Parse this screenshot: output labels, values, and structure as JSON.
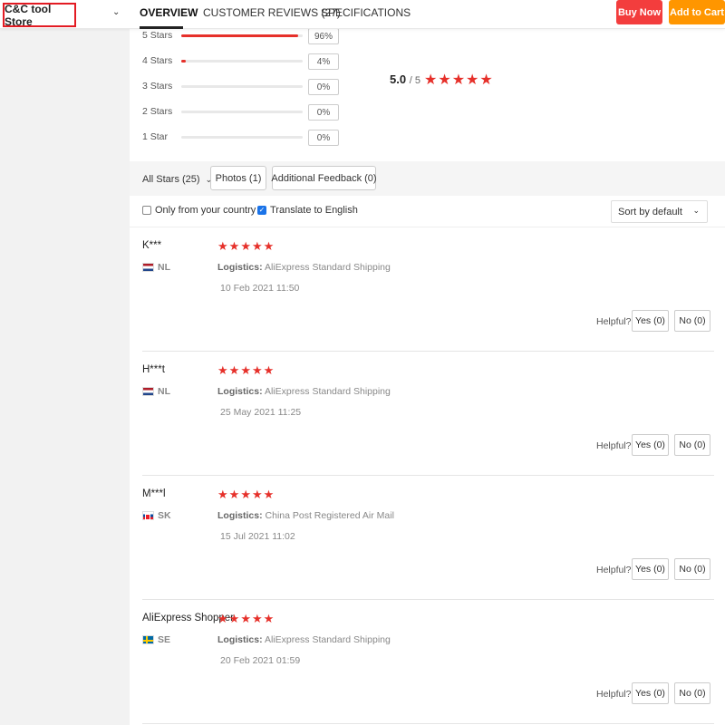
{
  "nav": {
    "store_name": "C&C tool Store",
    "tabs": [
      "OVERVIEW",
      "CUSTOMER REVIEWS (27)",
      "SPECIFICATIONS"
    ],
    "buy_now": "Buy Now",
    "add_to_cart": "Add to Cart"
  },
  "histogram": [
    {
      "label": "5 Stars",
      "pct": "96%",
      "fraction": 0.96
    },
    {
      "label": "4 Stars",
      "pct": "4%",
      "fraction": 0.04
    },
    {
      "label": "3 Stars",
      "pct": "0%",
      "fraction": 0
    },
    {
      "label": "2 Stars",
      "pct": "0%",
      "fraction": 0
    },
    {
      "label": "1 Star",
      "pct": "0%",
      "fraction": 0
    }
  ],
  "score": {
    "value": "5.0",
    "out_of": "/ 5",
    "stars": 5
  },
  "filters": {
    "all_stars": "All Stars (25)",
    "photos": "Photos (1)",
    "additional": "Additional Feedback (0)",
    "only_country": "Only from your country",
    "only_country_checked": false,
    "translate": "Translate to English",
    "translate_checked": true,
    "sort": "Sort by default"
  },
  "review_labels": {
    "logistics": "Logistics:",
    "helpful": "Helpful?",
    "yes": "Yes (0)",
    "no": "No (0)"
  },
  "reviews": [
    {
      "name": "K***",
      "country": "NL",
      "flag": "nl",
      "stars": 5,
      "logistics": "AliExpress Standard Shipping",
      "date": "10 Feb 2021 11:50"
    },
    {
      "name": "H***t",
      "country": "NL",
      "flag": "nl",
      "stars": 5,
      "logistics": "AliExpress Standard Shipping",
      "date": "25 May 2021 11:25"
    },
    {
      "name": "M***l",
      "country": "SK",
      "flag": "sk",
      "stars": 5,
      "logistics": "China Post Registered Air Mail",
      "date": "15 Jul 2021 11:02"
    },
    {
      "name": "AliExpress Shopper",
      "country": "SE",
      "flag": "se",
      "stars": 5,
      "logistics": "AliExpress Standard Shipping",
      "date": "20 Feb 2021 01:59"
    }
  ],
  "colors": {
    "accent_red": "#e6302a",
    "buy_now": "#f33d3d",
    "add_to_cart": "#ff9600"
  }
}
